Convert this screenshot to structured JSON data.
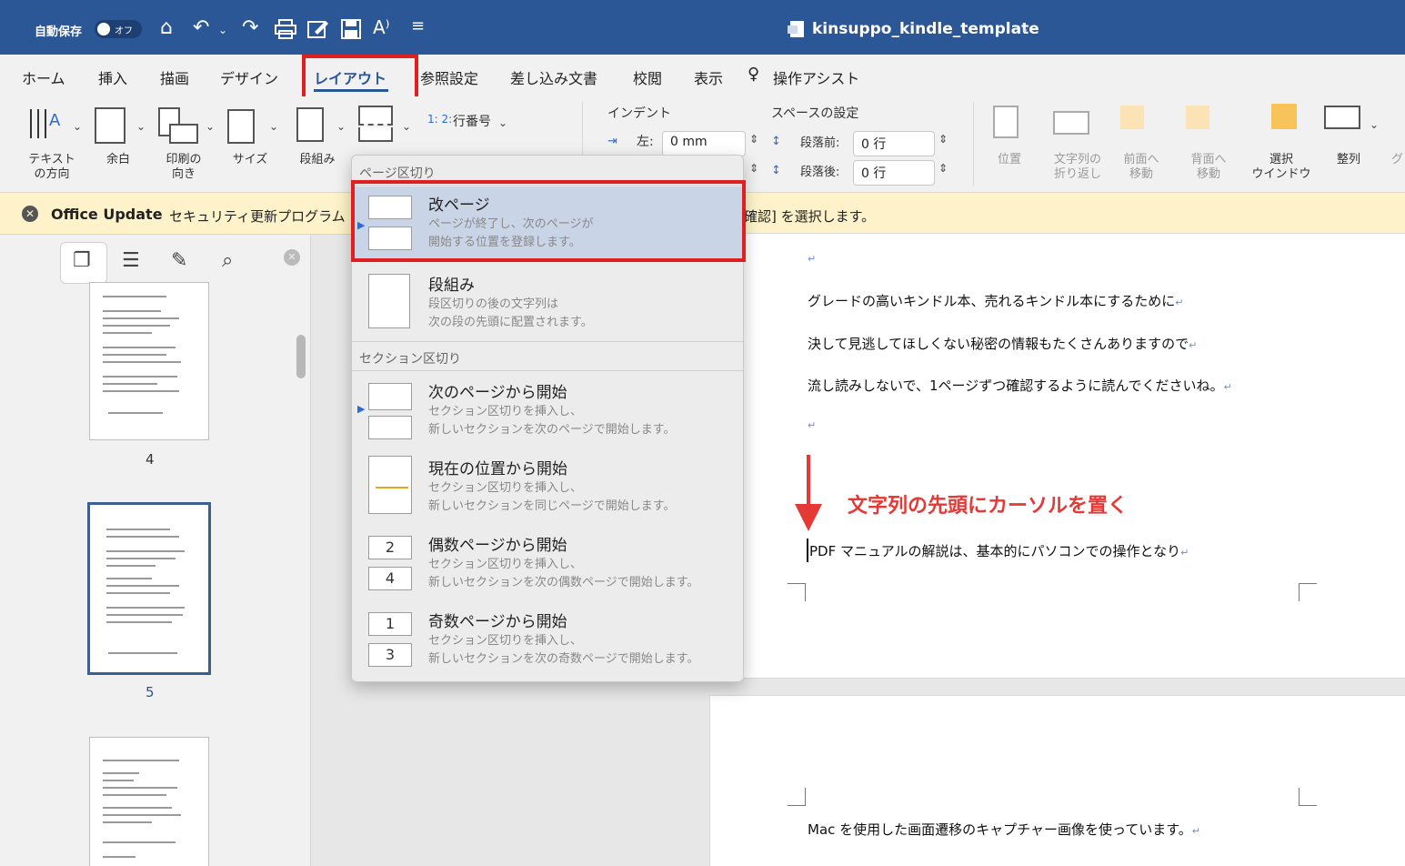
{
  "titlebar": {
    "autosave_label": "自動保存",
    "autosave_state": "オフ",
    "doc_title": "kinsuppo_kindle_template",
    "qat_icons": [
      "home-icon",
      "undo-icon",
      "redo-icon",
      "print-icon",
      "edit-icon",
      "save-icon",
      "read-aloud-icon",
      "customize-icon"
    ]
  },
  "tabs": [
    "ホーム",
    "挿入",
    "描画",
    "デザイン",
    "レイアウト",
    "参照設定",
    "差し込み文書",
    "校閲",
    "表示"
  ],
  "assist_label": "操作アシスト",
  "ribbon": {
    "text_direction": "テキスト\nの方向",
    "margins": "余白",
    "orientation": "印刷の\n向き",
    "size": "サイズ",
    "columns": "段組み",
    "line_numbers": "行番号",
    "indent_label": "インデント",
    "indent_left_label": "左:",
    "indent_left_value": "0 mm",
    "spacing_label": "スペースの設定",
    "spacing_before_label": "段落前:",
    "spacing_before_value": "0 行",
    "spacing_after_label": "段落後:",
    "spacing_after_value": "0 行",
    "position": "位置",
    "wrap_text": "文字列の\n折り返し",
    "bring_forward": "前面へ\n移動",
    "send_backward": "背面へ\n移動",
    "selection_pane": "選択\nウインドウ",
    "align": "整列",
    "group": "グ"
  },
  "notice": {
    "title": "Office Update",
    "message_start": "セキュリティ更新プログラム",
    "message_end": "確認] を選択します。"
  },
  "nav": {
    "page_numbers": [
      "4",
      "5"
    ]
  },
  "document": {
    "lines": [
      "グレードの高いキンドル本、売れるキンドル本にするために",
      "決して見逃してほしくない秘密の情報もたくさんありますので",
      "流し読みしないで、1ページずつ確認するように読んでくださいね。"
    ],
    "callout": "文字列の先頭にカーソルを置く",
    "cursor_line": "PDF マニュアルの解説は、基本的にパソコンでの操作となり",
    "page2_line": "Mac を使用した画面遷移のキャプチャー画像を使っています。",
    "return_mark": "↵"
  },
  "menu": {
    "section_page_breaks": "ページ区切り",
    "section_section_breaks": "セクション区切り",
    "items": [
      {
        "title": "改ページ",
        "desc1": "ページが終了し、次のページが",
        "desc2": "開始する位置を登録します。"
      },
      {
        "title": "段組み",
        "desc1": "段区切りの後の文字列は",
        "desc2": "次の段の先頭に配置されます。"
      },
      {
        "title": "次のページから開始",
        "desc1": "セクション区切りを挿入し、",
        "desc2": "新しいセクションを次のページで開始します。"
      },
      {
        "title": "現在の位置から開始",
        "desc1": "セクション区切りを挿入し、",
        "desc2": "新しいセクションを同じページで開始します。"
      },
      {
        "title": "偶数ページから開始",
        "desc1": "セクション区切りを挿入し、",
        "desc2": "新しいセクションを次の偶数ページで開始します。"
      },
      {
        "title": "奇数ページから開始",
        "desc1": "セクション区切りを挿入し、",
        "desc2": "新しいセクションを次の奇数ページで開始します。"
      }
    ],
    "even_icon_numbers": [
      "2",
      "4"
    ],
    "odd_icon_numbers": [
      "1",
      "3"
    ]
  },
  "colors": {
    "titlebar": "#2b5797",
    "highlight_red": "#e02020",
    "menu_highlight": "#c9d4e6",
    "notice_bg": "#fdf2c9"
  }
}
